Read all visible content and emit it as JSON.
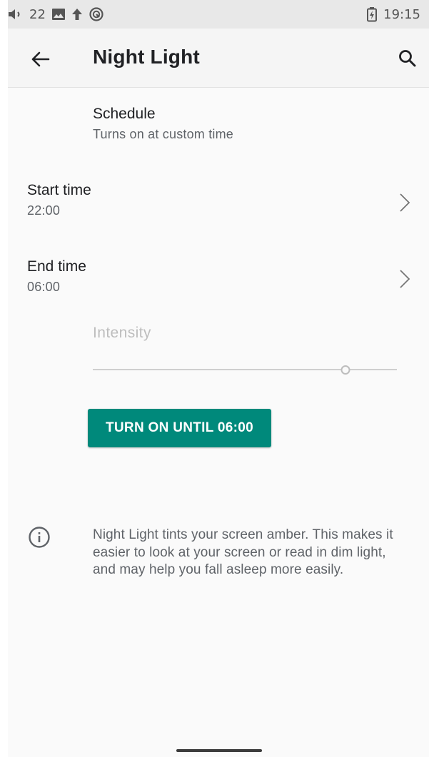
{
  "status_bar": {
    "volume_level": "22",
    "time": "19:15",
    "icons": [
      "volume-icon",
      "image-notification-icon",
      "upload-icon",
      "sync-icon",
      "battery-charging-icon"
    ]
  },
  "toolbar": {
    "title": "Night Light",
    "back_icon": "arrow-back-icon",
    "search_icon": "search-icon"
  },
  "schedule": {
    "title": "Schedule",
    "summary": "Turns on at custom time"
  },
  "start_time": {
    "title": "Start time",
    "value": "22:00"
  },
  "end_time": {
    "title": "End time",
    "value": "06:00"
  },
  "intensity": {
    "label": "Intensity",
    "level": 0.83
  },
  "action_button": {
    "label": "TURN ON UNTIL 06:00",
    "color": "#00897b"
  },
  "info": {
    "icon": "info-icon",
    "text": "Night Light tints your screen amber. This makes it easier to look at your screen or read in dim light, and may help you fall asleep more easily."
  }
}
